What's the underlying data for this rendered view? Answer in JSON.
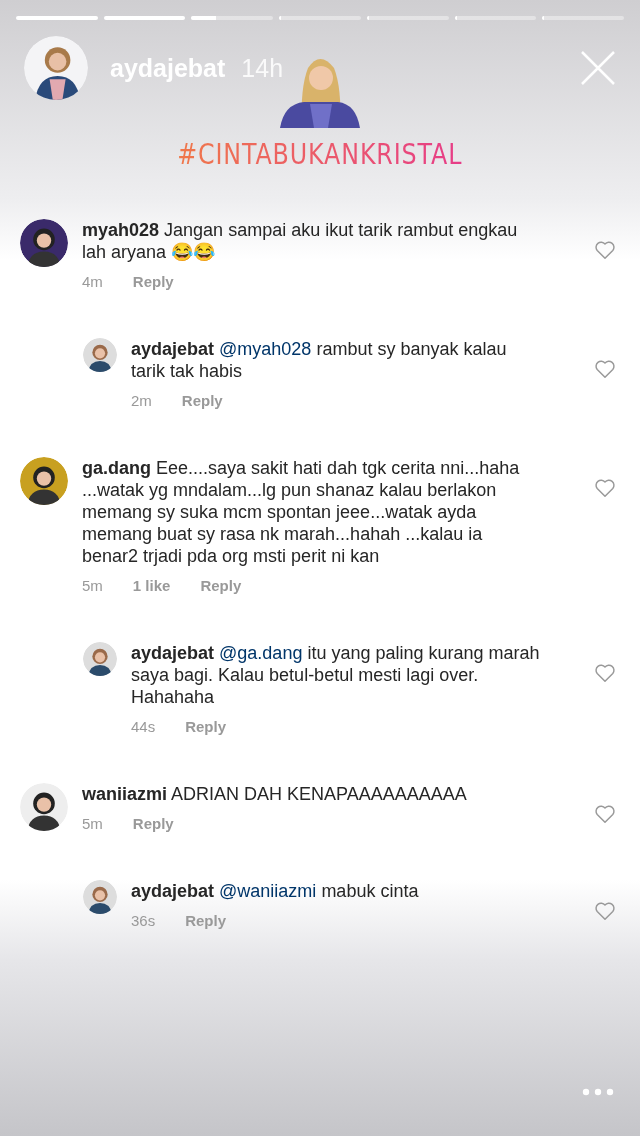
{
  "progress": [
    {
      "level": 1
    },
    {
      "level": 1
    },
    {
      "level": 0.3
    },
    {
      "level": 0
    },
    {
      "level": 0
    },
    {
      "level": 0
    },
    {
      "level": 0
    }
  ],
  "header": {
    "username": "aydajebat",
    "time": "14h"
  },
  "hashtag": "#CINTABUKANKRISTAL",
  "comments": [
    {
      "username": "myah028",
      "text": "Jangan sampai aku ikut tarik rambut engkau lah aryana 😂😂",
      "time": "4m",
      "reply": "Reply",
      "replies": [
        {
          "username": "aydajebat",
          "mention": "@myah028",
          "text": "rambut sy banyak kalau tarik tak habis",
          "time": "2m",
          "reply": "Reply"
        }
      ]
    },
    {
      "username": "ga.dang",
      "text": "Eee....saya sakit hati dah tgk cerita nni...haha ...watak yg mndalam...lg pun shanaz kalau berlakon memang sy suka mcm spontan jeee...watak ayda memang buat sy rasa nk marah...hahah ...kalau ia benar2 trjadi pda org msti perit ni kan",
      "time": "5m",
      "likes": "1 like",
      "reply": "Reply",
      "replies": [
        {
          "username": "aydajebat",
          "mention": "@ga.dang",
          "text": "itu yang paling kurang marah saya bagi. Kalau betul-betul mesti lagi over. Hahahaha",
          "time": "44s",
          "reply": "Reply"
        }
      ]
    },
    {
      "username": "waniiazmi",
      "text": "ADRIAN DAH KENAPAAAAAAAAAA",
      "time": "5m",
      "reply": "Reply",
      "replies": [
        {
          "username": "aydajebat",
          "mention": "@waniiazmi",
          "text": "mabuk cinta",
          "time": "36s",
          "reply": "Reply"
        }
      ]
    }
  ]
}
